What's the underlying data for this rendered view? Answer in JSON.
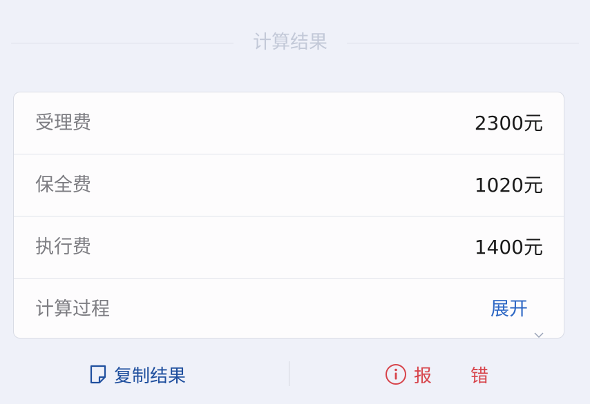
{
  "section_title": "计算结果",
  "fees": [
    {
      "label": "受理费",
      "value": "2300元"
    },
    {
      "label": "保全费",
      "value": "1020元"
    },
    {
      "label": "执行费",
      "value": "1400元"
    }
  ],
  "process": {
    "label": "计算过程",
    "toggle_label": "展开"
  },
  "actions": {
    "copy_label": "复制结果",
    "report_label": "报错"
  },
  "colors": {
    "background": "#eff1f9",
    "link_blue": "#2c66c4",
    "copy_blue": "#1f4f9e",
    "error_red": "#d7434a"
  },
  "icons": {
    "copy": "document-copy-icon",
    "report": "info-circle-icon",
    "toggle": "chevron-down-icon"
  }
}
